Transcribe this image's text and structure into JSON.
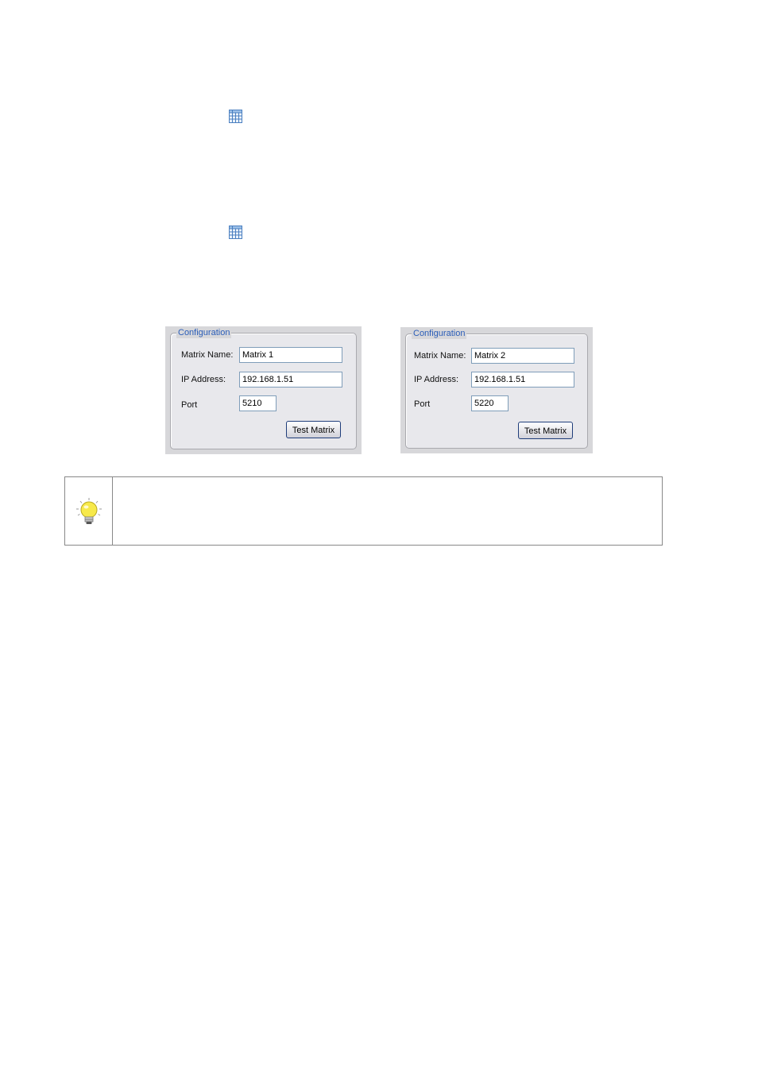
{
  "icons": {
    "grid_icon_1": "grid-icon",
    "grid_icon_2": "grid-icon",
    "tip_icon": "lightbulb-icon"
  },
  "panels": [
    {
      "legend": "Configuration",
      "matrix_name_label": "Matrix Name:",
      "matrix_name_value": "Matrix 1",
      "ip_label": "IP Address:",
      "ip_value": "192.168.1.51",
      "port_label": "Port",
      "port_value": "5210",
      "button_label": "Test Matrix"
    },
    {
      "legend": "Configuration",
      "matrix_name_label": "Matrix Name:",
      "matrix_name_value": "Matrix 2",
      "ip_label": "IP Address:",
      "ip_value": "192.168.1.51",
      "port_label": "Port",
      "port_value": "5220",
      "button_label": "Test Matrix"
    }
  ],
  "colors": {
    "legend_text": "#2a5db8",
    "panel_bg": "#d7d7da",
    "bulb_yellow": "#f7e94a"
  }
}
